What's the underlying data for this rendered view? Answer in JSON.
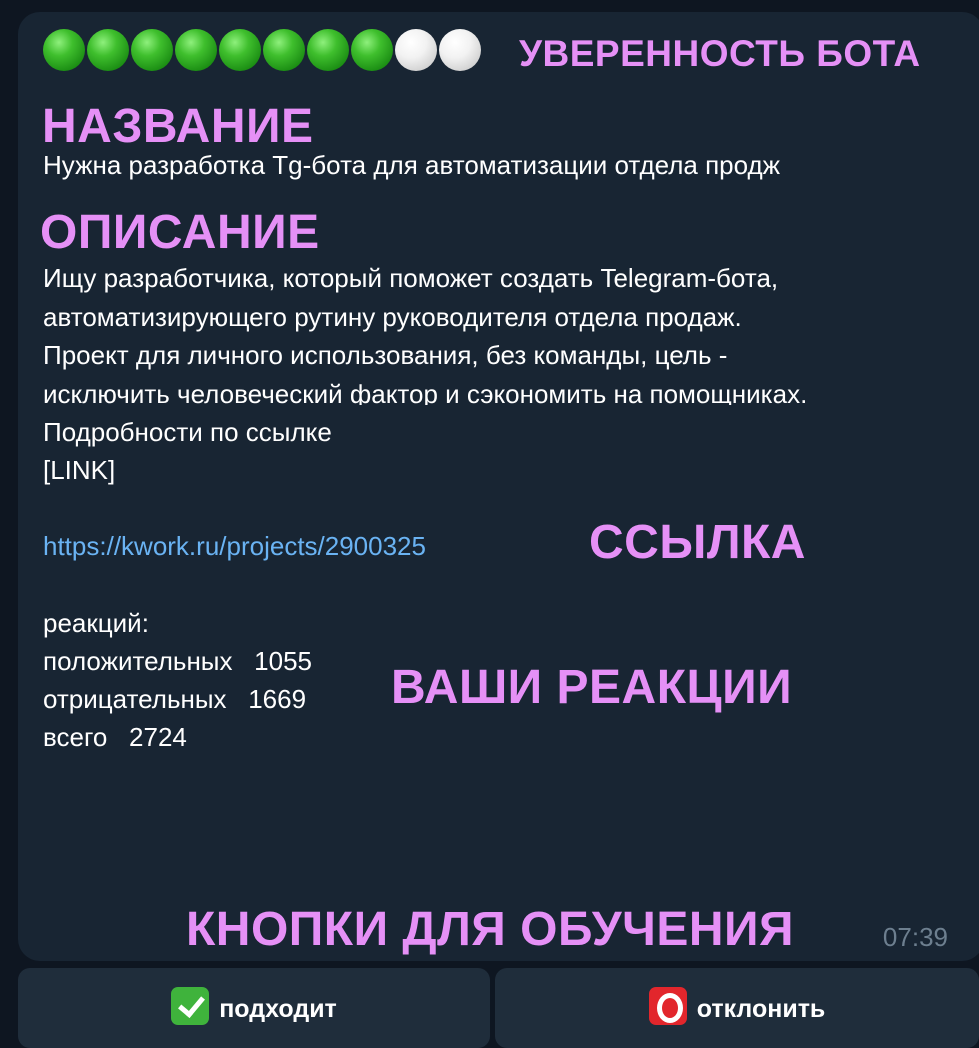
{
  "confidence": {
    "dots": [
      "on",
      "on",
      "on",
      "on",
      "on",
      "on",
      "on",
      "on",
      "off",
      "off"
    ],
    "filled": 8,
    "total": 10,
    "label": "УВЕРЕННОСТЬ БОТА"
  },
  "annotations": {
    "title": "НАЗВАНИЕ",
    "description": "ОПИСАНИЕ",
    "link": "ССЫЛКА",
    "reactions": "ВАШИ РЕАКЦИИ",
    "buttons": "КНОПКИ ДЛЯ ОБУЧЕНИЯ"
  },
  "message": {
    "title": "Нужна разработка Tg-бота для автоматизации отдела продж",
    "description_lines": [
      "Ищу разработчика, который поможет создать Telegram-бота,",
      "автоматизирующего рутину руководителя отдела продаж.",
      "Проект для личного использования, без команды, цель -",
      "исключить человеческий фактор и сэкономить на помощниках."
    ],
    "details_line": "Подробности по ссылке",
    "link_placeholder": "[LINK]",
    "url": "https://kwork.ru/projects/2900325",
    "reactions_header": "реакций:",
    "positive_label": "положительных",
    "positive_count": "1055",
    "negative_label": "отрицательных",
    "negative_count": "1669",
    "total_label": "всего",
    "total_count": "2724",
    "time": "07:39"
  },
  "buttons": {
    "approve_label": "подходит",
    "approve_icon": "check-mark-icon",
    "reject_label": "отклонить",
    "reject_icon": "red-circle-icon"
  },
  "colors": {
    "background": "#0e1621",
    "bubble": "#182533",
    "annotation": "#e590f6",
    "link": "#6ab3f3",
    "button": "#1f2d3b"
  }
}
